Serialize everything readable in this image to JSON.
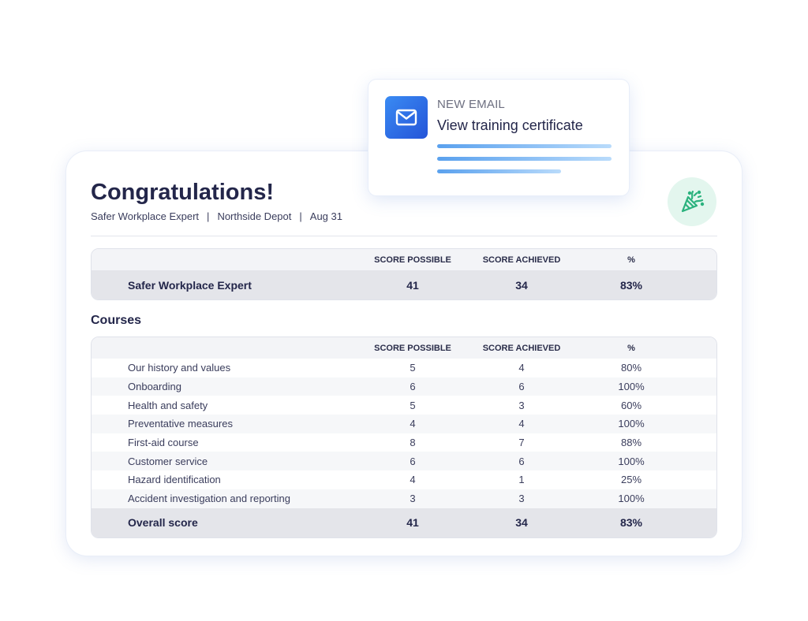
{
  "email": {
    "kicker": "NEW EMAIL",
    "subject": "View training certificate",
    "icon": "envelope-icon",
    "accent": "#2f6ee6"
  },
  "report": {
    "title": "Congratulations!",
    "meta": {
      "program": "Safer Workplace Expert",
      "location": "Northside Depot",
      "date": "Aug 31",
      "separator": "|"
    },
    "badge_icon": "party-popper-icon",
    "badge_color": "#2bb27e"
  },
  "summary_table": {
    "headers": [
      "SCORE POSSIBLE",
      "SCORE ACHIEVED",
      "%"
    ],
    "row": {
      "name": "Safer Workplace Expert",
      "possible": "41",
      "achieved": "34",
      "percent": "83%"
    }
  },
  "courses": {
    "label": "Courses",
    "headers": [
      "SCORE POSSIBLE",
      "SCORE ACHIEVED",
      "%"
    ],
    "rows": [
      {
        "name": "Our history and values",
        "possible": "5",
        "achieved": "4",
        "percent": "80%"
      },
      {
        "name": "Onboarding",
        "possible": "6",
        "achieved": "6",
        "percent": "100%"
      },
      {
        "name": "Health and safety",
        "possible": "5",
        "achieved": "3",
        "percent": "60%"
      },
      {
        "name": "Preventative measures",
        "possible": "4",
        "achieved": "4",
        "percent": "100%"
      },
      {
        "name": "First-aid course",
        "possible": "8",
        "achieved": "7",
        "percent": "88%"
      },
      {
        "name": "Customer service",
        "possible": "6",
        "achieved": "6",
        "percent": "100%"
      },
      {
        "name": "Hazard identification",
        "possible": "4",
        "achieved": "1",
        "percent": "25%"
      },
      {
        "name": "Accident investigation and reporting",
        "possible": "3",
        "achieved": "3",
        "percent": "100%"
      }
    ],
    "total": {
      "name": "Overall score",
      "possible": "41",
      "achieved": "34",
      "percent": "83%"
    }
  }
}
